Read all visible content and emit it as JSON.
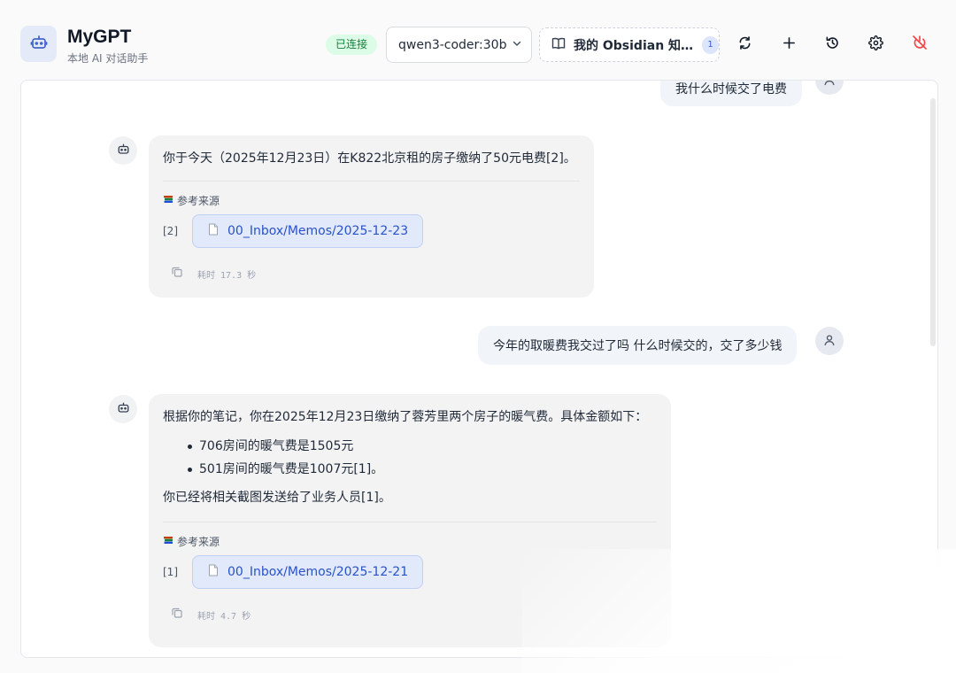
{
  "header": {
    "title": "MyGPT",
    "subtitle": "本地 AI 对话助手",
    "status": "已连接",
    "model": "qwen3-coder:30b",
    "knowledge_base": "我的 Obsidian 知…",
    "knowledge_count": "1"
  },
  "messages": [
    {
      "role": "user",
      "text": "我什么时候交了电费"
    },
    {
      "role": "assistant",
      "text": "你于今天（2025年12月23日）在K822北京租的房子缴纳了50元电费[2]。",
      "sources_label": "参考来源",
      "sources": [
        {
          "index": "[2]",
          "title": "00_Inbox/Memos/2025-12-23"
        }
      ],
      "time": "耗时 17.3 秒"
    },
    {
      "role": "user",
      "text": "今年的取暖费我交过了吗 什么时候交的，交了多少钱"
    },
    {
      "role": "assistant",
      "intro": "根据你的笔记，你在2025年12月23日缴纳了蓉芳里两个房子的暖气费。具体金额如下：",
      "items": [
        "706房间的暖气费是1505元",
        "501房间的暖气费是1007元[1]。"
      ],
      "outro": "你已经将相关截图发送给了业务人员[1]。",
      "sources_label": "参考来源",
      "sources": [
        {
          "index": "[1]",
          "title": "00_Inbox/Memos/2025-12-21"
        }
      ],
      "time": "耗时 4.7 秒"
    }
  ],
  "icons": {
    "logo": "robot-icon",
    "model_dropdown": "chevron-down-icon",
    "knowledge_base": "book-icon",
    "toolbar": [
      "refresh-icon",
      "plus-icon",
      "history-icon",
      "gear-icon",
      "power-off-icon"
    ],
    "user_avatar": "user-icon",
    "bot_avatar": "robot-icon",
    "sources": "books-icon",
    "source_doc": "document-icon",
    "copy": "copy-icon"
  },
  "colors": {
    "accent": "#2952c8",
    "status_bg": "#dcfce7",
    "status_text": "#16803d",
    "danger": "#ef4444"
  }
}
